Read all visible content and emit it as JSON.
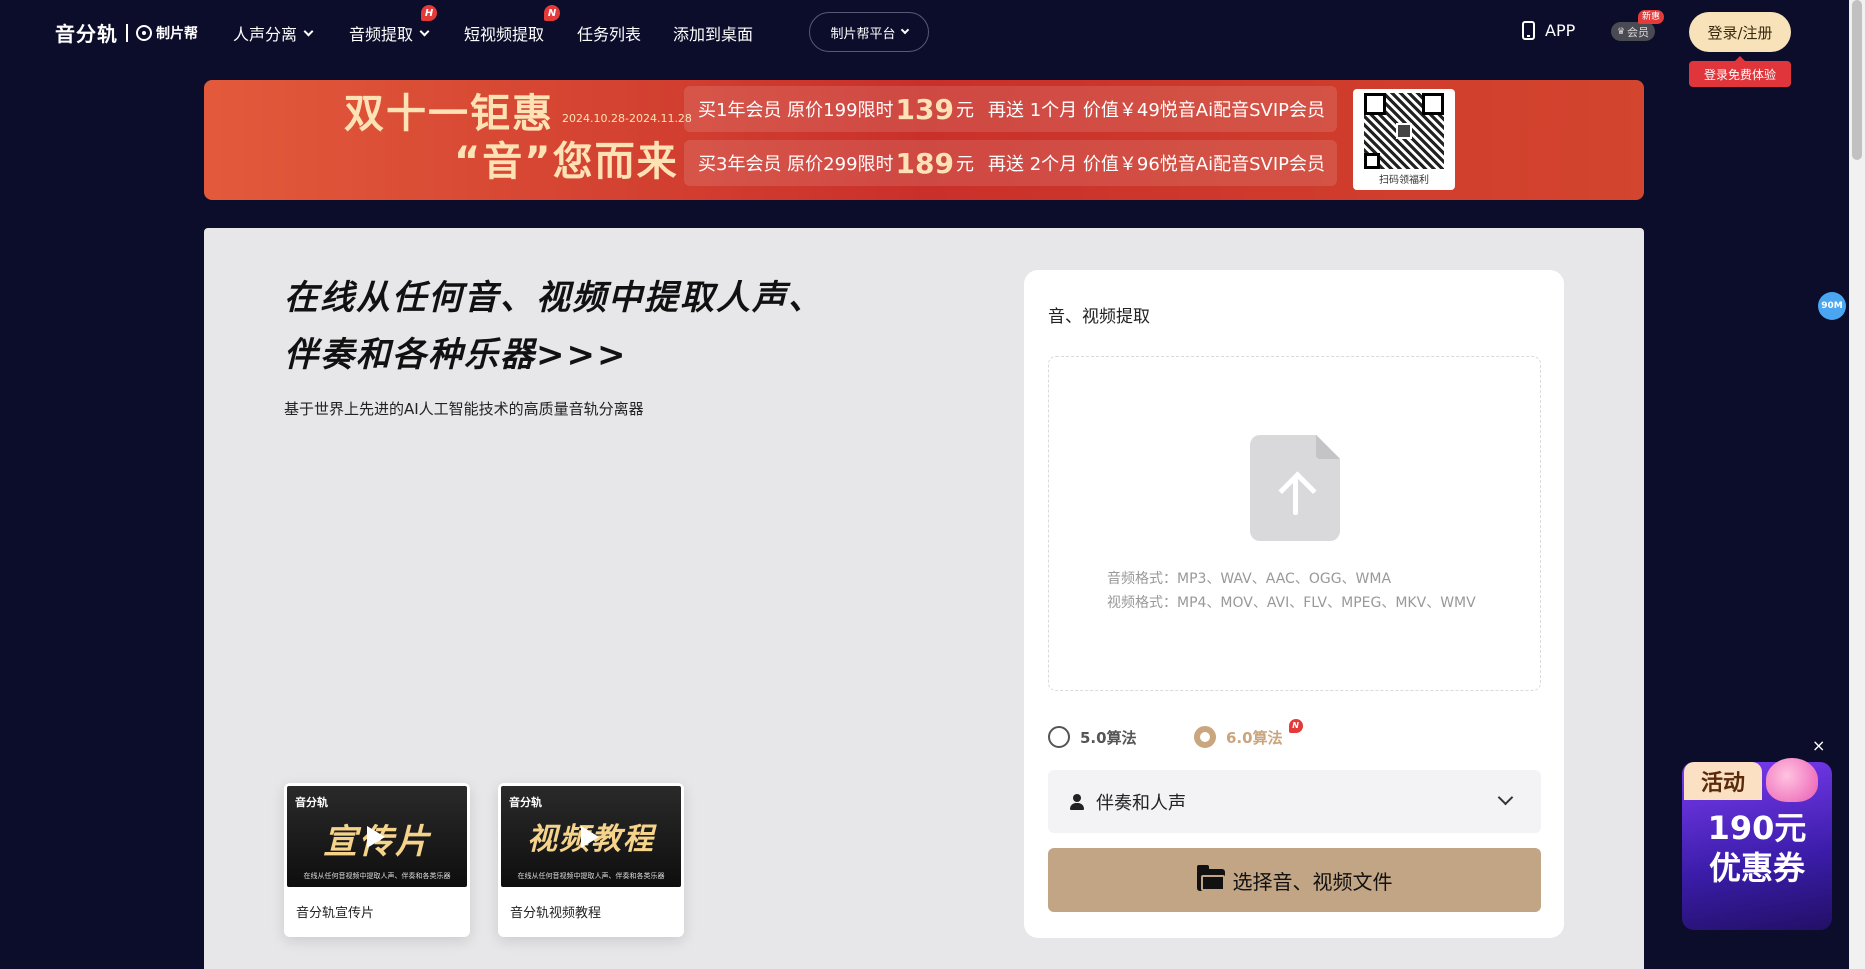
{
  "nav": {
    "logo_main": "音分轨",
    "logo_sub": "制片帮",
    "items": [
      {
        "label": "人声分离",
        "has_dropdown": true,
        "badge": ""
      },
      {
        "label": "音频提取",
        "has_dropdown": true,
        "badge": "H"
      },
      {
        "label": "短视频提取",
        "has_dropdown": false,
        "badge": "N"
      },
      {
        "label": "任务列表",
        "has_dropdown": false,
        "badge": ""
      },
      {
        "label": "添加到桌面",
        "has_dropdown": false,
        "badge": ""
      }
    ],
    "platform": "制片帮平台",
    "app": "APP",
    "vip_chip": "会员",
    "vip_new": "新惠",
    "login": "登录/注册",
    "login_tip": "登录免费体验"
  },
  "banner": {
    "title_line1": "双十一钜惠",
    "title_line2": "“音”您而来",
    "date_range": "2024.10.28-2024.11.28",
    "offer1": {
      "prefix": "买1年会员  原价199限时",
      "price": "139",
      "unit": "元",
      "suffix": "再送 1个月 价值￥49悦音Ai配音SVIP会员"
    },
    "offer2": {
      "prefix": "买3年会员  原价299限时",
      "price": "189",
      "unit": "元",
      "suffix": "再送 2个月 价值￥96悦音Ai配音SVIP会员"
    },
    "qr_label": "扫码领福利"
  },
  "hero": {
    "title": "在线从任何音、视频中提取人声、伴奏和各种乐器>>>",
    "subtitle": "基于世界上先进的AI人工智能技术的高质量音轨分离器"
  },
  "videos": [
    {
      "brand": "音分轨",
      "thumb_text": "宣传片",
      "caption": "在线从任何音视频中提取人声、伴奏和各类乐器",
      "label": "音分轨宣传片"
    },
    {
      "brand": "音分轨",
      "thumb_text": "视频教程",
      "caption": "在线从任何音视频中提取人声、伴奏和各类乐器",
      "label": "音分轨视频教程"
    }
  ],
  "upload": {
    "title": "音、视频提取",
    "audio_formats": "音频格式：MP3、WAV、AAC、OGG、WMA",
    "video_formats": "视频格式：MP4、MOV、AVI、FLV、MPEG、MKV、WMV",
    "algo1": "5.0算法",
    "algo2": "6.0算法",
    "algo2_badge": "N",
    "selected_algo": "6.0算法",
    "mode": "伴奏和人声",
    "choose_button": "选择音、视频文件"
  },
  "floating": {
    "size_badge": "90M",
    "promo_tab": "活动",
    "promo_line1": "190元",
    "promo_line2": "优惠券",
    "close": "×"
  },
  "colors": {
    "background": "#0c0d2a",
    "accent_gold": "#c1a584",
    "login_bg": "#f7e2b9",
    "badge_red": "#e53a3a"
  }
}
